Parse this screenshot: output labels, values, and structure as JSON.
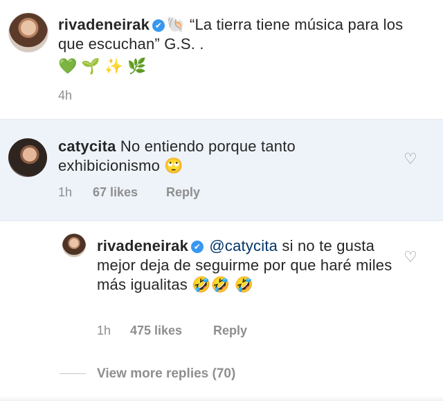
{
  "caption": {
    "username": "rivadeneirak",
    "verified_icon": "✔",
    "shell_emoji": "🐚",
    "text": "“La tierra tiene música para los que escuchan” G.S. .",
    "emojis": [
      "💚",
      "🌱",
      "✨",
      "🌿"
    ],
    "time": "4h"
  },
  "comment": {
    "username": "catycita",
    "text": "No entiendo porque tanto exhibicionismo 🙄",
    "time": "1h",
    "likes": "67 likes",
    "reply_label": "Reply"
  },
  "reply": {
    "username": "rivadeneirak",
    "verified_icon": "✔",
    "mention": "@catycita",
    "text": "si no te gusta mejor deja de seguirme por que haré miles más igualitas 🤣🤣 🤣",
    "time": "1h",
    "likes": "475 likes",
    "reply_label": "Reply"
  },
  "view_more": "View more replies (70)",
  "icons": {
    "heart": "♡"
  },
  "colors": {
    "verified": "#3897f0",
    "highlight_bg": "#eef3f9",
    "muted": "#8e8e8e",
    "mention": "#003569"
  }
}
